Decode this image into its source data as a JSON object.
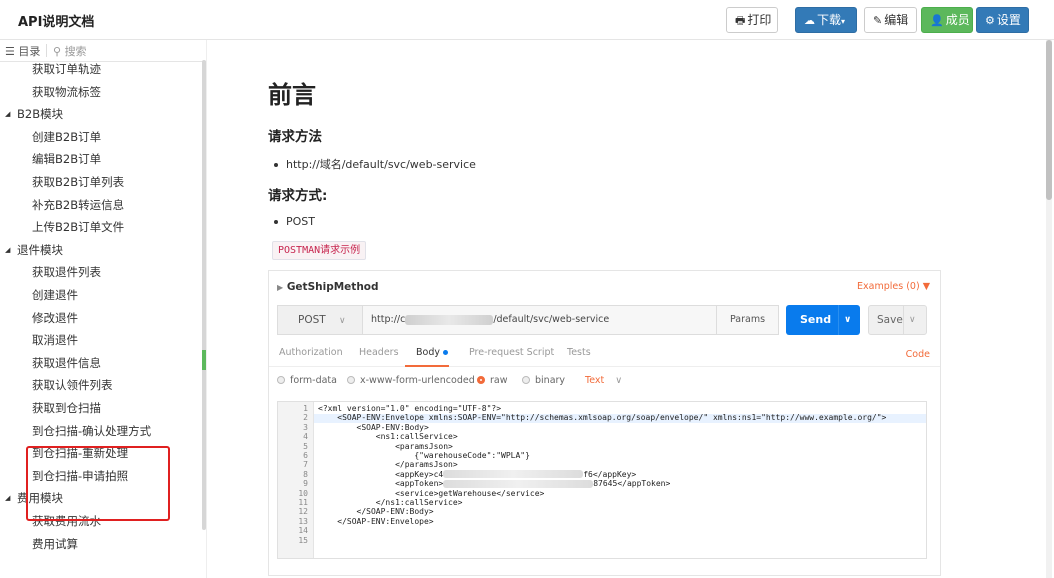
{
  "header": {
    "title": "API说明文档",
    "buttons": {
      "print": "打印",
      "download": "下载",
      "edit": "编辑",
      "member": "成员",
      "settings": "设置"
    }
  },
  "sidebar": {
    "tab_toc": "目录",
    "tab_search": "搜索",
    "items": [
      {
        "label": "获取订单轨迹",
        "type": "leaf"
      },
      {
        "label": "获取物流标签",
        "type": "leaf"
      },
      {
        "label": "B2B模块",
        "type": "group"
      },
      {
        "label": "创建B2B订单",
        "type": "leaf"
      },
      {
        "label": "编辑B2B订单",
        "type": "leaf"
      },
      {
        "label": "获取B2B订单列表",
        "type": "leaf"
      },
      {
        "label": "补充B2B转运信息",
        "type": "leaf"
      },
      {
        "label": "上传B2B订单文件",
        "type": "leaf"
      },
      {
        "label": "退件模块",
        "type": "group"
      },
      {
        "label": "获取退件列表",
        "type": "leaf"
      },
      {
        "label": "创建退件",
        "type": "leaf"
      },
      {
        "label": "修改退件",
        "type": "leaf"
      },
      {
        "label": "取消退件",
        "type": "leaf"
      },
      {
        "label": "获取退件信息",
        "type": "leaf"
      },
      {
        "label": "获取认领件列表",
        "type": "leaf"
      },
      {
        "label": "获取到仓扫描",
        "type": "leaf"
      },
      {
        "label": "到仓扫描-确认处理方式",
        "type": "leaf"
      },
      {
        "label": "到仓扫描-重新处理",
        "type": "leaf"
      },
      {
        "label": "到仓扫描-申请拍照",
        "type": "leaf"
      },
      {
        "label": "费用模块",
        "type": "group"
      },
      {
        "label": "获取费用流水",
        "type": "leaf"
      },
      {
        "label": "费用试算",
        "type": "leaf"
      }
    ]
  },
  "main": {
    "title": "前言",
    "section1": "请求方法",
    "endpoint": "http://域名/default/svc/web-service",
    "section2": "请求方式:",
    "method": "POST",
    "code_tag": "POSTMAN请求示例"
  },
  "postman": {
    "request_name": "GetShipMethod",
    "examples": "Examples (0) ▼",
    "method": "POST",
    "url_prefix": "http://c",
    "url_suffix": "/default/svc/web-service",
    "params": "Params",
    "send": "Send",
    "save": "Save",
    "tabs": [
      "Authorization",
      "Headers",
      "Body",
      "Pre-request Script",
      "Tests"
    ],
    "code_link": "Code",
    "body_types": [
      "form-data",
      "x-www-form-urlencoded",
      "raw",
      "binary"
    ],
    "text_type": "Text",
    "code_lines": [
      "<?xml version=\"1.0\" encoding=\"UTF-8\"?>",
      "    <SOAP-ENV:Envelope xmlns:SOAP-ENV=\"http://schemas.xmlsoap.org/soap/envelope/\" xmlns:ns1=\"http://www.example.org/\">",
      "        <SOAP-ENV:Body>",
      "            <ns1:callService>",
      "                <paramsJson>",
      "                    {\"warehouseCode\":\"WPLA\"}",
      "                </paramsJson>",
      "                <appKey>c4",
      "                <appToken>",
      "                <service>getWarehouse</service>",
      "            </ns1:callService>",
      "        </SOAP-ENV:Body>",
      "    </SOAP-ENV:Envelope>",
      "",
      ""
    ],
    "line7_tail": "f6</appKey>",
    "line8_tail": "87645</appToken>"
  }
}
